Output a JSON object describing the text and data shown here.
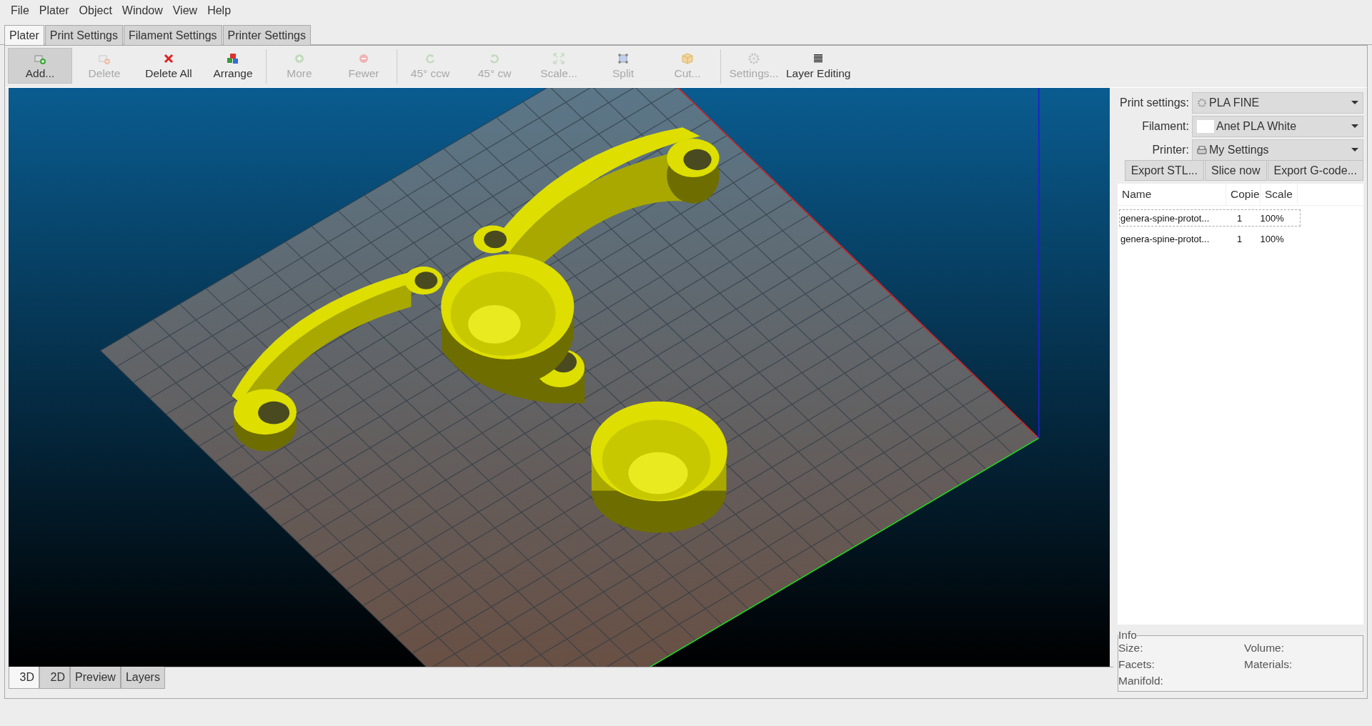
{
  "menu": [
    "File",
    "Plater",
    "Object",
    "Window",
    "View",
    "Help"
  ],
  "tabs": [
    {
      "label": "Plater",
      "selected": true
    },
    {
      "label": "Print Settings",
      "selected": false
    },
    {
      "label": "Filament Settings",
      "selected": false
    },
    {
      "label": "Printer Settings",
      "selected": false
    }
  ],
  "toolbar": [
    [
      {
        "label": "Add...",
        "kind": "add",
        "disabled": false,
        "pressed": true
      },
      {
        "label": "Delete",
        "kind": "delete",
        "disabled": true,
        "pressed": false
      },
      {
        "label": "Delete All",
        "kind": "delete-all",
        "disabled": false,
        "pressed": false
      },
      {
        "label": "Arrange",
        "kind": "arrange",
        "disabled": false,
        "pressed": false
      }
    ],
    [
      {
        "label": "More",
        "kind": "more",
        "disabled": true,
        "pressed": false
      },
      {
        "label": "Fewer",
        "kind": "fewer",
        "disabled": true,
        "pressed": false
      }
    ],
    [
      {
        "label": "45° ccw",
        "kind": "rotate-ccw",
        "disabled": true,
        "pressed": false
      },
      {
        "label": "45° cw",
        "kind": "rotate-cw",
        "disabled": true,
        "pressed": false
      },
      {
        "label": "Scale...",
        "kind": "scale",
        "disabled": true,
        "pressed": false
      },
      {
        "label": "Split",
        "kind": "split",
        "disabled": true,
        "pressed": false
      },
      {
        "label": "Cut...",
        "kind": "cut",
        "disabled": true,
        "pressed": false
      }
    ],
    [
      {
        "label": "Settings...",
        "kind": "settings",
        "disabled": true,
        "pressed": false
      },
      {
        "label": "Layer Editing",
        "kind": "layers",
        "disabled": false,
        "pressed": false
      }
    ]
  ],
  "view_tabs": [
    {
      "label": "3D",
      "selected": true
    },
    {
      "label": "2D",
      "selected": false
    },
    {
      "label": "Preview",
      "selected": false
    },
    {
      "label": "Layers",
      "selected": false
    }
  ],
  "presets": [
    {
      "label": "Print settings:",
      "value": "PLA FINE",
      "kind": "gear"
    },
    {
      "label": "Filament:",
      "value": "Anet PLA White",
      "kind": "swatch",
      "color": "#ffffff"
    },
    {
      "label": "Printer:",
      "value": "My Settings",
      "kind": "printer"
    }
  ],
  "actions": [
    "Export STL...",
    "Slice now",
    "Export G-code..."
  ],
  "objects": {
    "columns": [
      "Name",
      "Copie",
      "Scale"
    ],
    "rows": [
      {
        "name": "genera-spine-protot...",
        "copies": "1",
        "scale": "100%",
        "selected": true
      },
      {
        "name": "genera-spine-protot...",
        "copies": "1",
        "scale": "100%",
        "selected": false
      }
    ]
  },
  "info": {
    "title": "Info",
    "labels": [
      "Size:",
      "Volume:",
      "Facets:",
      "Materials:",
      "Manifold:"
    ]
  }
}
